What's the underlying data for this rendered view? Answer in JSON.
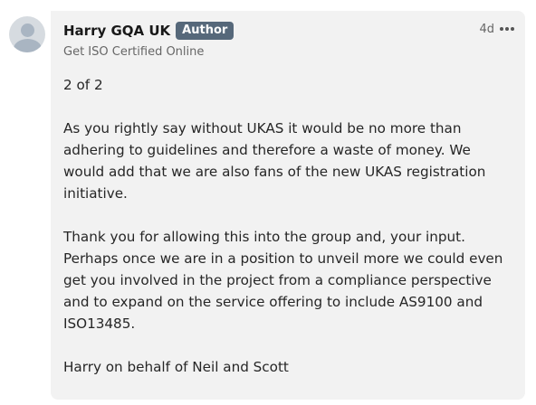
{
  "comment": {
    "author_name": "Harry GQA UK",
    "author_badge": "Author",
    "headline": "Get ISO Certified Online",
    "time": "4d",
    "paragraphs": [
      "2 of 2",
      "As you rightly say without UKAS it would be no more than adhering to guidelines and therefore a waste of money. We would add that we are also fans of the new UKAS registration initiative.",
      "Thank you for allowing this into the group and, your input. Perhaps once we are in a position to unveil more we could even get you involved in the project from a compliance perspective and to expand on the service offering to include AS9100 and ISO13485.",
      "Harry on behalf of Neil and Scott"
    ]
  },
  "icons": {
    "avatar": "person-avatar-icon",
    "more": "more-options-icon"
  },
  "colors": {
    "badge_bg": "#56687a",
    "bubble_bg": "#f2f2f2",
    "text": "#262626"
  }
}
